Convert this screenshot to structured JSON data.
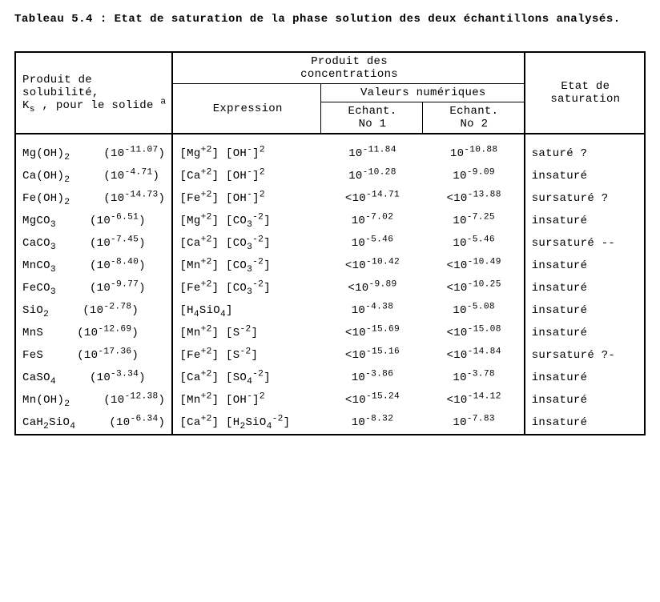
{
  "caption": "Tableau 5.4  :  Etat de saturation de la phase solution des deux échantillons analysés.",
  "headers": {
    "solubility_html": "Produit de solubilité,<br>K<sub>s</sub> , pour le solide <sup>a</sup>",
    "concentrations": "Produit des concentrations",
    "concentrations_l1": "Produit des",
    "concentrations_l2": "concentrations",
    "expression": "Expression",
    "values": "Valeurs numériques",
    "ech1_l1": "Echant.",
    "ech1_l2": "No 1",
    "ech2_l1": "Echant.",
    "ech2_l2": "No 2",
    "state_l1": "Etat de",
    "state_l2": "saturation"
  },
  "rows": [
    {
      "compound_html": "Mg(OH)<sub>2</sub>",
      "ks_html": "(10<sup>-11.07</sup>)",
      "expr_html": "[Mg<sup>+2</sup>] [OH<sup>-</sup>]<sup>2</sup>",
      "v1_html": "10<sup>-11.84</sup>",
      "v2_html": "10<sup>-10.88</sup>",
      "state": "saturé   ?"
    },
    {
      "compound_html": "Ca(OH)<sub>2</sub>",
      "ks_html": "(10<sup>-4.71</sup>)",
      "expr_html": "[Ca<sup>+2</sup>] [OH<sup>-</sup>]<sup>2</sup>",
      "v1_html": "10<sup>-10.28</sup>",
      "v2_html": "10<sup>-9.09</sup>",
      "state": "insaturé"
    },
    {
      "compound_html": "Fe(OH)<sub>2</sub>",
      "ks_html": "(10<sup>-14.73</sup>)",
      "expr_html": "[Fe<sup>+2</sup>] [OH<sup>-</sup>]<sup>2</sup>",
      "v1_html": "&lt;10<sup>-14.71</sup>",
      "v2_html": "&lt;10<sup>-13.88</sup>",
      "state": "sursaturé ?"
    },
    {
      "compound_html": "MgCO<sub>3</sub>",
      "ks_html": "(10<sup>-6.51</sup>)",
      "expr_html": "[Mg<sup>+2</sup>] [CO<sub>3</sub><sup>-2</sup>]",
      "v1_html": "10<sup>-7.02</sup>",
      "v2_html": "10<sup>-7.25</sup>",
      "state": "insaturé"
    },
    {
      "compound_html": "CaCO<sub>3</sub>",
      "ks_html": "(10<sup>-7.45</sup>)",
      "expr_html": "[Ca<sup>+2</sup>] [CO<sub>3</sub><sup>-2</sup>]",
      "v1_html": "10<sup>-5.46</sup>",
      "v2_html": "10<sup>-5.46</sup>",
      "state": "sursaturé --"
    },
    {
      "compound_html": "MnCO<sub>3</sub>",
      "ks_html": "(10<sup>-8.40</sup>)",
      "expr_html": "[Mn<sup>+2</sup>] [CO<sub>3</sub><sup>-2</sup>]",
      "v1_html": "&lt;10<sup>-10.42</sup>",
      "v2_html": "&lt;10<sup>-10.49</sup>",
      "state": "insaturé"
    },
    {
      "compound_html": "FeCO<sub>3</sub>",
      "ks_html": "(10<sup>-9.77</sup>)",
      "expr_html": "[Fe<sup>+2</sup>] [CO<sub>3</sub><sup>-2</sup>]",
      "v1_html": "&lt;10<sup>-9.89</sup>",
      "v2_html": "&lt;10<sup>-10.25</sup>",
      "state": "insaturé"
    },
    {
      "compound_html": "SiO<sub>2</sub>",
      "ks_html": "(10<sup>-2.78</sup>)",
      "expr_html": "[H<sub>4</sub>SiO<sub>4</sub>]",
      "v1_html": "10<sup>-4.38</sup>",
      "v2_html": "10<sup>-5.08</sup>",
      "state": "insaturé"
    },
    {
      "compound_html": "MnS",
      "ks_html": "(10<sup>-12.69</sup>)",
      "expr_html": "[Mn<sup>+2</sup>] [S<sup>-2</sup>]",
      "v1_html": "&lt;10<sup>-15.69</sup>",
      "v2_html": "&lt;10<sup>-15.08</sup>",
      "state": "insaturé"
    },
    {
      "compound_html": "FeS",
      "ks_html": "(10<sup>-17.36</sup>)",
      "expr_html": "[Fe<sup>+2</sup>] [S<sup>-2</sup>]",
      "v1_html": "&lt;10<sup>-15.16</sup>",
      "v2_html": "&lt;10<sup>-14.84</sup>",
      "state": "sursaturé ?-"
    },
    {
      "compound_html": "CaSO<sub>4</sub>",
      "ks_html": "(10<sup>-3.34</sup>)",
      "expr_html": "[Ca<sup>+2</sup>] [SO<sub>4</sub><sup>-2</sup>]",
      "v1_html": "10<sup>-3.86</sup>",
      "v2_html": "10<sup>-3.78</sup>",
      "state": "insaturé"
    },
    {
      "compound_html": "Mn(OH)<sub>2</sub>",
      "ks_html": "(10<sup>-12.38</sup>)",
      "expr_html": "[Mn<sup>+2</sup>] [OH<sup>-</sup>]<sup>2</sup>",
      "v1_html": "&lt;10<sup>-15.24</sup>",
      "v2_html": "&lt;10<sup>-14.12</sup>",
      "state": "insaturé"
    },
    {
      "compound_html": "CaH<sub>2</sub>SiO<sub>4</sub>",
      "ks_html": "(10<sup>-6.34</sup>)",
      "expr_html": "[Ca<sup>+2</sup>] [H<sub>2</sub>SiO<sub>4</sub><sup>-2</sup>]",
      "v1_html": "10<sup>-8.32</sup>",
      "v2_html": "10<sup>-7.83</sup>",
      "state": "insaturé"
    }
  ]
}
